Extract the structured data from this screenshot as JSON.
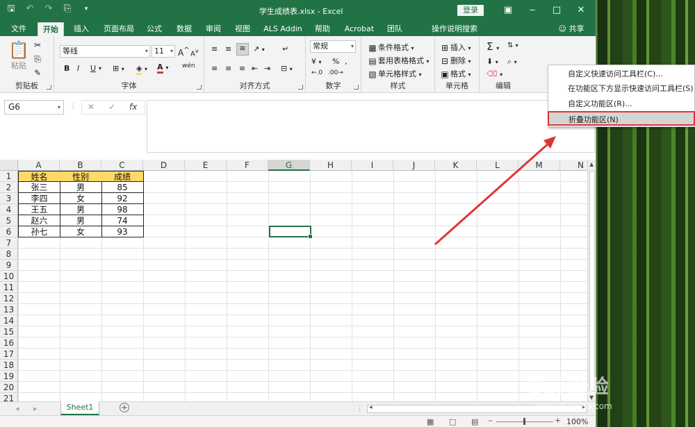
{
  "window": {
    "title": "学生成绩表.xlsx  -  Excel",
    "login": "登录",
    "share": "共享"
  },
  "tabs": [
    "文件",
    "开始",
    "插入",
    "页面布局",
    "公式",
    "数据",
    "审阅",
    "视图",
    "ALS Addin",
    "帮助",
    "Acrobat",
    "团队",
    "操作说明搜索"
  ],
  "ribbon": {
    "clipboard": {
      "label": "剪贴板",
      "paste": "粘贴"
    },
    "font": {
      "label": "字体",
      "name": "等线",
      "size": "11",
      "bold": "B",
      "italic": "I",
      "underline": "U",
      "grow": "A",
      "shrink": "A",
      "phonetic": "wén"
    },
    "alignment": {
      "label": "对齐方式"
    },
    "number": {
      "label": "数字",
      "format": "常规",
      "percent": "%"
    },
    "styles": {
      "label": "样式",
      "conditional": "条件格式",
      "table": "套用表格格式",
      "cell": "单元格样式"
    },
    "cells": {
      "label": "单元格",
      "insert": "插入",
      "delete": "删除",
      "format": "格式"
    },
    "editing": {
      "label": "编辑"
    }
  },
  "formula_bar": {
    "namebox": "G6",
    "fx": "fx",
    "value": ""
  },
  "columns": [
    "A",
    "B",
    "C",
    "D",
    "E",
    "F",
    "G",
    "H",
    "I",
    "J",
    "K",
    "L",
    "M",
    "N"
  ],
  "rows": [
    "1",
    "2",
    "3",
    "4",
    "5",
    "6",
    "7",
    "8",
    "9",
    "10",
    "11",
    "12",
    "13",
    "14",
    "15",
    "16",
    "17",
    "18",
    "19",
    "20",
    "21"
  ],
  "table": {
    "header": [
      "姓名",
      "性别",
      "成绩"
    ],
    "rows": [
      [
        "张三",
        "男",
        "85"
      ],
      [
        "李四",
        "女",
        "92"
      ],
      [
        "王五",
        "男",
        "98"
      ],
      [
        "赵六",
        "男",
        "74"
      ],
      [
        "孙七",
        "女",
        "93"
      ]
    ]
  },
  "selected_column": "G",
  "sheet": {
    "name": "Sheet1"
  },
  "status": {
    "zoom": "100%"
  },
  "context_menu": [
    "自定义快速访问工具栏(C)...",
    "在功能区下方显示快速访问工具栏(S)",
    "自定义功能区(R)...",
    "折叠功能区(N)"
  ],
  "watermark": {
    "main": "Bai 经验",
    "url": "jingyan.baidu.com"
  },
  "colors": {
    "excel_green": "#217346",
    "header_fill": "#ffd966",
    "highlight": "#e03434"
  }
}
